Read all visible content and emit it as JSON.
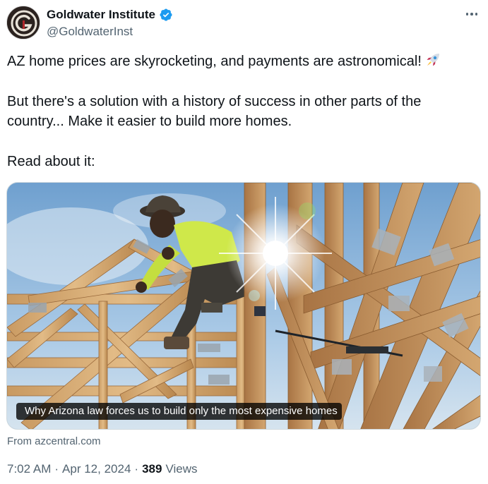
{
  "author": {
    "display_name": "Goldwater Institute",
    "handle": "@GoldwaterInst",
    "verified_icon": "verified-badge-icon",
    "avatar_icon": "goldwater-logo-icon"
  },
  "tweet": {
    "line1": "AZ home prices are skyrocketing, and payments are astronomical!",
    "line1_emoji": "rocket-icon",
    "line2a": "But there's a solution with a history of success in other parts of the",
    "line2b": "country... Make it easier to build more homes.",
    "line3": "Read about it:"
  },
  "card": {
    "caption": "Why Arizona law forces us to build only the most expensive homes",
    "source": "From azcentral.com"
  },
  "meta": {
    "time": "7:02 AM",
    "separator": "·",
    "date": "Apr 12, 2024",
    "views_count": "389",
    "views_label": "Views"
  },
  "colors": {
    "accent": "#1d9bf0",
    "text": "#0f1419",
    "secondary": "#536471",
    "border": "#cfd9de"
  }
}
